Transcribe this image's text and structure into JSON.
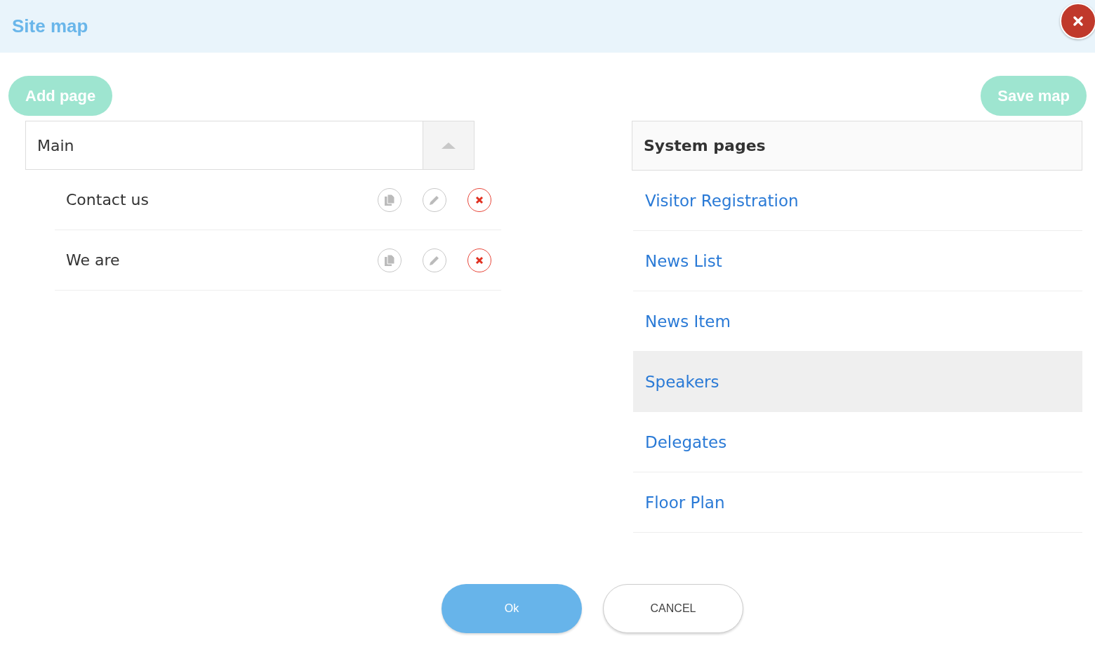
{
  "window": {
    "title": "Site map"
  },
  "toolbar": {
    "add_button": "Add page",
    "save_button": "Save map"
  },
  "tree": {
    "label": "Main",
    "expanded": true,
    "children": [
      {
        "label": "Contact us"
      },
      {
        "label": "We are"
      }
    ]
  },
  "system_pages": {
    "title": "System pages",
    "items": [
      {
        "label": "Visitor Registration",
        "highlighted": false
      },
      {
        "label": "News List",
        "highlighted": false
      },
      {
        "label": "News Item",
        "highlighted": false
      },
      {
        "label": "Speakers",
        "highlighted": true
      },
      {
        "label": "Delegates",
        "highlighted": false
      },
      {
        "label": "Floor Plan",
        "highlighted": false
      }
    ]
  },
  "footer": {
    "ok": "Ok",
    "cancel": "CANCEL"
  }
}
